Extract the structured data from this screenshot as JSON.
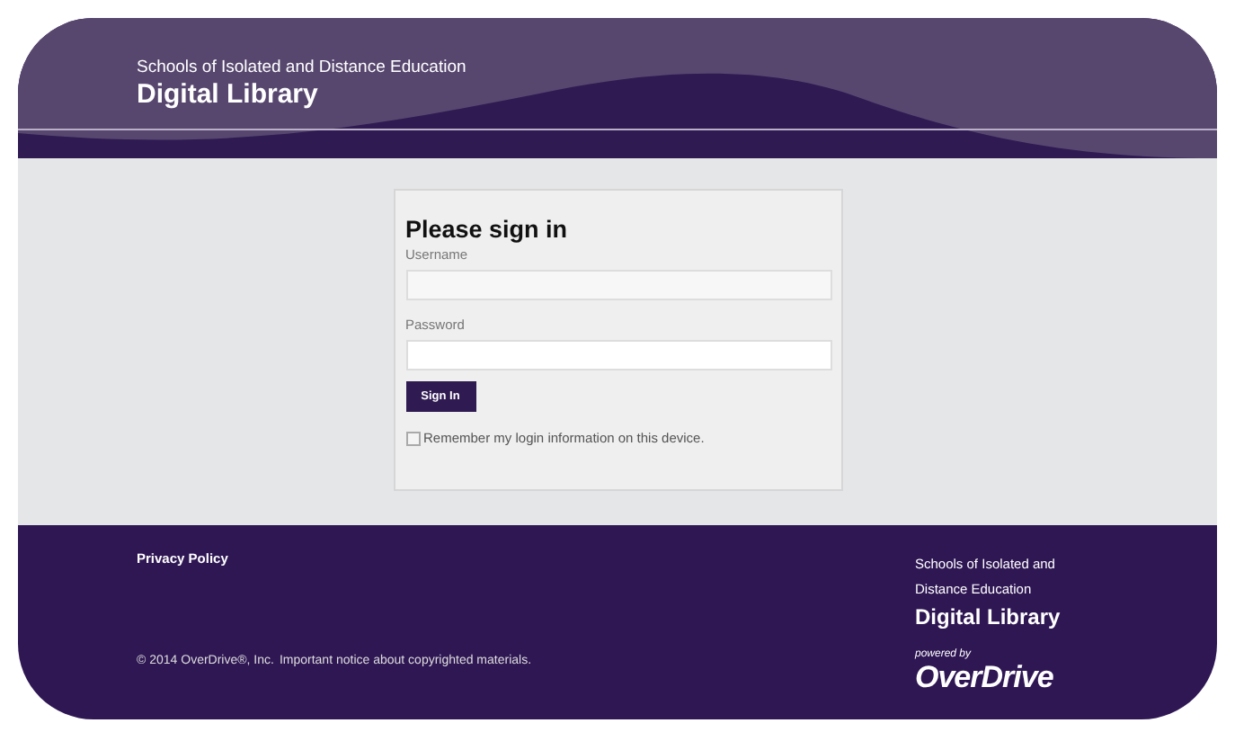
{
  "header": {
    "subtitle": "Schools of Isolated and Distance Education",
    "title": "Digital Library"
  },
  "sign_in": {
    "heading": "Please sign in",
    "fields": [
      {
        "label": "Username",
        "kind": "text"
      },
      {
        "label": "Password",
        "kind": "password"
      }
    ],
    "button": "Sign In",
    "remember": {
      "label": "Remember my login information on this device.",
      "checked": false
    }
  },
  "footer": {
    "privacy_link": "Privacy Policy",
    "copyright": "© 2014 OverDrive®, Inc.",
    "notice_link": "Important notice about copyrighted materials.",
    "library_subtitle": "Schools of Isolated and Distance Education",
    "library_title": "Digital Library",
    "powered_by": "powered by",
    "brand": "OverDrive"
  }
}
